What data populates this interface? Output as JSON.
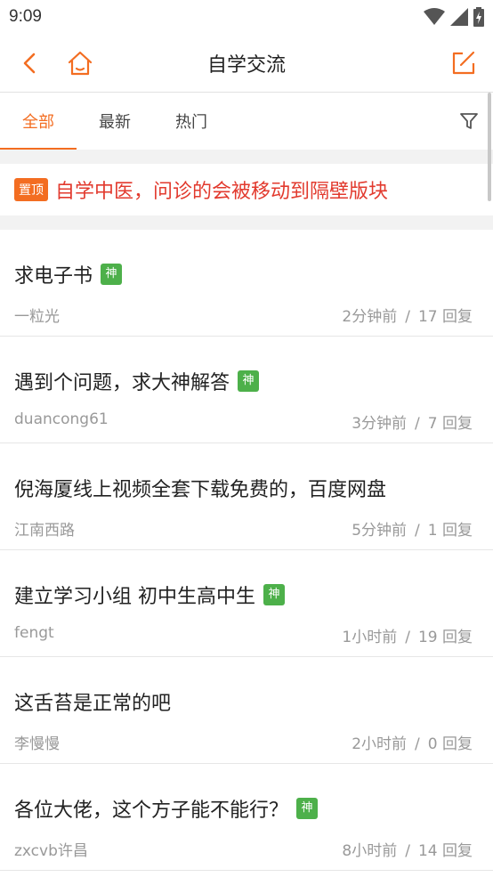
{
  "status": {
    "time": "9:09"
  },
  "header": {
    "title": "自学交流"
  },
  "tabs": [
    {
      "label": "全部"
    },
    {
      "label": "最新"
    },
    {
      "label": "热门"
    }
  ],
  "pinned": {
    "badge": "置顶",
    "text": "自学中医，问诊的会被移动到隔壁版块"
  },
  "posts": [
    {
      "title": "求电子书",
      "badge": "神",
      "author": "一粒光",
      "time": "2分钟前",
      "replies": "17 回复"
    },
    {
      "title": "遇到个问题，求大神解答",
      "badge": "神",
      "author": "duancong61",
      "time": "3分钟前",
      "replies": "7 回复"
    },
    {
      "title": "倪海厦线上视频全套下载免费的，百度网盘",
      "badge": "",
      "author": "江南西路",
      "time": "5分钟前",
      "replies": "1 回复"
    },
    {
      "title": "建立学习小组 初中生高中生",
      "badge": "神",
      "author": "fengt",
      "time": "1小时前",
      "replies": "19 回复"
    },
    {
      "title": "这舌苔是正常的吧",
      "badge": "",
      "author": "李慢慢",
      "time": "2小时前",
      "replies": "0 回复"
    },
    {
      "title": "各位大佬，这个方子能不能行？",
      "badge": "神",
      "author": "zxcvb许昌",
      "time": "8小时前",
      "replies": "14 回复"
    }
  ],
  "colors": {
    "accent": "#f36d21",
    "pinned_text": "#e23a2e",
    "badge_green": "#4db04a"
  },
  "icons": [
    "back-arrow-icon",
    "home-icon",
    "compose-icon",
    "filter-icon",
    "wifi-icon",
    "signal-icon",
    "battery-icon"
  ]
}
